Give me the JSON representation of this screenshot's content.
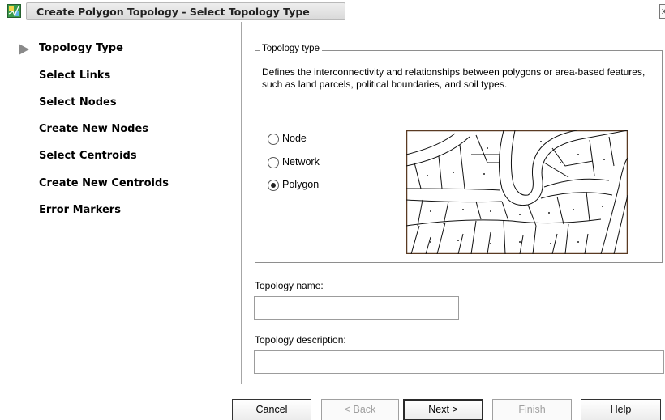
{
  "window": {
    "title": "Create Polygon Topology - Select Topology Type",
    "close_glyph": "x"
  },
  "steps": [
    {
      "label": "Topology Type",
      "current": true
    },
    {
      "label": "Select Links"
    },
    {
      "label": "Select Nodes"
    },
    {
      "label": "Create New Nodes"
    },
    {
      "label": "Select Centroids"
    },
    {
      "label": "Create New Centroids"
    },
    {
      "label": "Error Markers"
    }
  ],
  "topology_type": {
    "legend": "Topology type",
    "description": "Defines the interconnectivity and relationships between polygons or area-based features, such as land parcels, political boundaries, and soil types.",
    "options": [
      {
        "label": "Node",
        "selected": false
      },
      {
        "label": "Network",
        "selected": false
      },
      {
        "label": "Polygon",
        "selected": true
      }
    ]
  },
  "name_field": {
    "label": "Topology name:",
    "value": ""
  },
  "description_field": {
    "label": "Topology description:",
    "value": ""
  },
  "buttons": {
    "cancel": "Cancel",
    "back": "< Back",
    "next": "Next >",
    "finish": "Finish",
    "help": "Help"
  },
  "icons": {
    "app": "map-topology-icon",
    "current_step": "triangle-right-icon"
  }
}
